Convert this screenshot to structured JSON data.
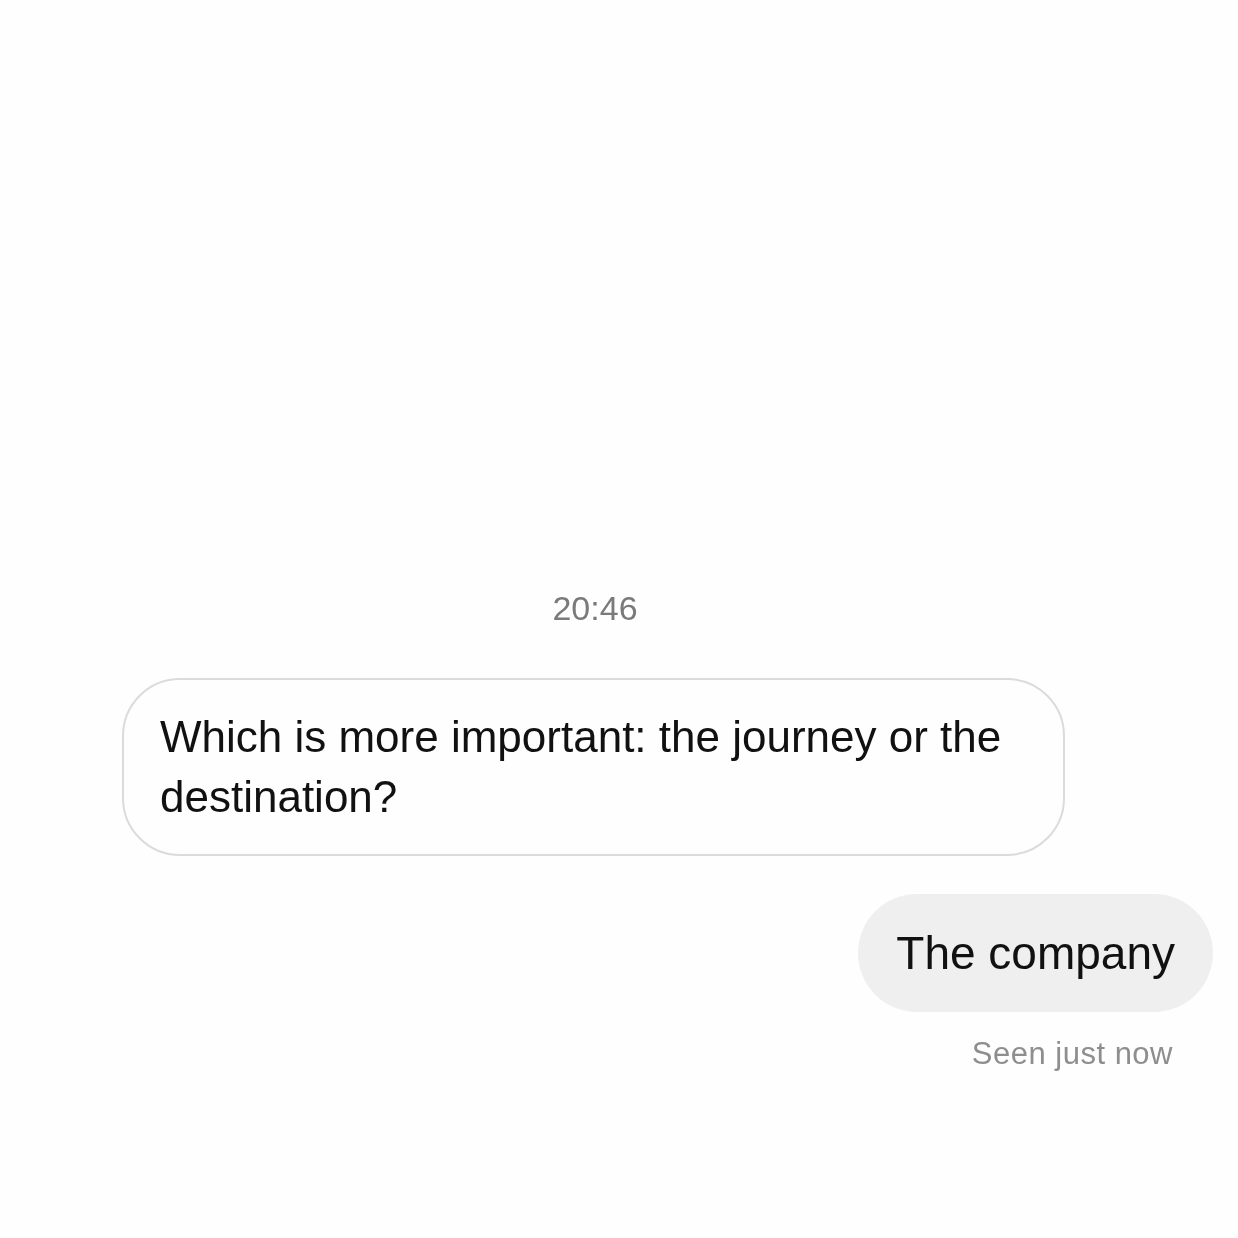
{
  "timestamp": "20:46",
  "messages": [
    {
      "kind": "received",
      "text": "Which is more important: the journey or the destination?"
    },
    {
      "kind": "sent",
      "text": "The company"
    }
  ],
  "status": "Seen just now"
}
